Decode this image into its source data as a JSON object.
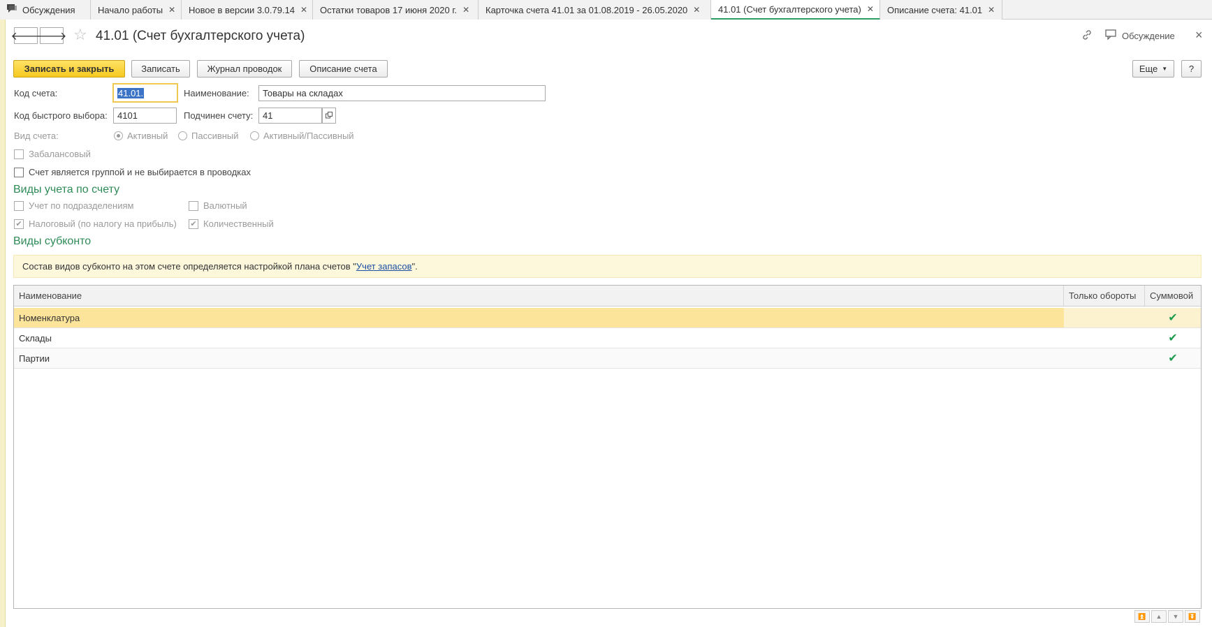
{
  "tabs": [
    {
      "label": "Обсуждения",
      "closable": false
    },
    {
      "label": "Начало работы",
      "closable": true
    },
    {
      "label": "Новое в версии 3.0.79.14",
      "closable": true
    },
    {
      "label": "Остатки товаров 17 июня 2020 г.",
      "closable": true
    },
    {
      "label": "Карточка счета 41.01 за 01.08.2019 - 26.05.2020",
      "closable": true
    },
    {
      "label": "41.01 (Счет бухгалтерского учета)",
      "closable": true,
      "active": true
    },
    {
      "label": "Описание счета: 41.01",
      "closable": true
    }
  ],
  "header": {
    "title": "41.01 (Счет бухгалтерского учета)",
    "discussion_label": "Обсуждение",
    "close_symbol": "×"
  },
  "toolbar": {
    "save_close": "Записать и закрыть",
    "save": "Записать",
    "journal": "Журнал проводок",
    "description": "Описание счета",
    "more": "Еще",
    "help": "?"
  },
  "form": {
    "code_label": "Код счета:",
    "code_value": "41.01.",
    "name_label": "Наименование:",
    "name_value": "Товары на складах",
    "quick_label": "Код быстрого выбора:",
    "quick_value": "4101",
    "parent_label": "Подчинен счету:",
    "parent_value": "41",
    "kind_label": "Вид счета:",
    "kind_options": [
      "Активный",
      "Пассивный",
      "Активный/Пассивный"
    ],
    "kind_selected": "Активный",
    "offbalance_label": "Забалансовый",
    "group_label": "Счет является группой и не выбирается в проводках"
  },
  "accounting": {
    "title": "Виды учета по счету",
    "by_division": "Учет по подразделениям",
    "currency": "Валютный",
    "tax": "Налоговый (по налогу на прибыль)",
    "quantity": "Количественный"
  },
  "subconto": {
    "title": "Виды субконто",
    "info_prefix": "Состав видов субконто на этом счете определяется настройкой плана счетов \"",
    "info_link": "Учет запасов",
    "info_suffix": "\".",
    "columns": [
      "Наименование",
      "Только обороты",
      "Суммовой"
    ],
    "rows": [
      {
        "name": "Номенклатура",
        "turnover_only": false,
        "sum": true
      },
      {
        "name": "Склады",
        "turnover_only": false,
        "sum": true
      },
      {
        "name": "Партии",
        "turnover_only": false,
        "sum": true
      }
    ]
  },
  "colors": {
    "accent_green": "#2e8b57",
    "primary_button": "#f6c91f",
    "selected_row": "#fde49b",
    "info_bg": "#fdf7dc"
  }
}
